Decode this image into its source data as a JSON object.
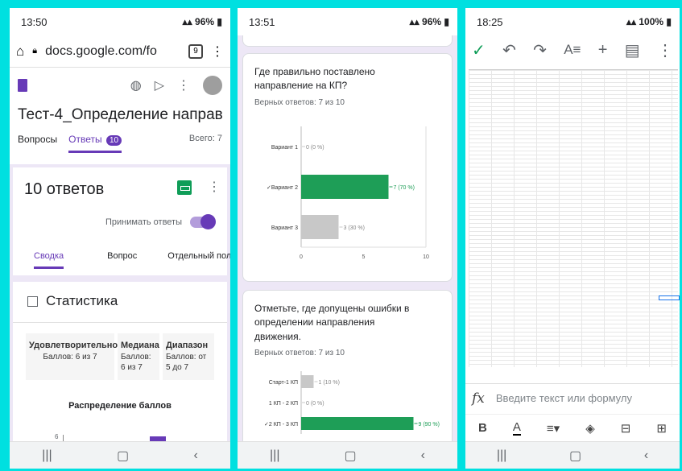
{
  "panel1": {
    "status": {
      "time": "13:50",
      "battery": "96%"
    },
    "url": "docs.google.com/fo",
    "tab_count": "9",
    "form_title": "Тест-4_Определение направл",
    "tabs": {
      "questions": "Вопросы",
      "responses": "Ответы",
      "responses_badge": "10",
      "total": "Всего: 7"
    },
    "responses_title": "10 ответов",
    "accept_label": "Принимать ответы",
    "subtabs": {
      "summary": "Сводка",
      "question": "Вопрос",
      "individual": "Отдельный польз"
    },
    "stats_title": "Статистика",
    "stats": [
      {
        "label": "Удовлетворительно",
        "value": "Баллов: 6 из 7"
      },
      {
        "label": "Медиана",
        "value": "Баллов: 6 из 7"
      },
      {
        "label": "Диапазон",
        "value": "Баллов: от 5 до 7"
      }
    ],
    "distribution_title": "Распределение баллов",
    "distribution_tick": "6"
  },
  "panel2": {
    "status": {
      "time": "13:51",
      "battery": "96%"
    },
    "q1": {
      "title": "Где правильно поставлено направление на КП?",
      "correct": "Верных ответов: 7 из 10"
    },
    "q2": {
      "title": "Отметьте, где допущены ошибки в определении направления движения.",
      "correct": "Верных ответов: 7 из 10"
    }
  },
  "panel3": {
    "status": {
      "time": "18:25",
      "battery": "100%"
    },
    "formula_placeholder": "Введите текст или формулу"
  },
  "colors": {
    "correct": "#1e9e57",
    "wrong": "#c8c8c8",
    "accent": "#673ab7"
  },
  "chart_data": [
    {
      "type": "bar",
      "orientation": "horizontal",
      "categories": [
        "Вариант 1",
        "✓Вариант 2",
        "Вариант 3"
      ],
      "values": [
        0,
        7,
        3
      ],
      "data_labels": [
        "0 (0 %)",
        "7 (70 %)",
        "3 (30 %)"
      ],
      "correct": [
        false,
        true,
        false
      ],
      "xlim": [
        0,
        10
      ],
      "xticks": [
        "0",
        "5",
        "10"
      ]
    },
    {
      "type": "bar",
      "orientation": "horizontal",
      "categories": [
        "Старт-1 КП",
        "1 КП - 2 КП",
        "✓2 КП - 3 КП"
      ],
      "values": [
        1,
        0,
        9
      ],
      "data_labels": [
        "1 (10 %)",
        "0 (0 %)",
        "9 (90 %)"
      ],
      "correct": [
        false,
        false,
        true
      ],
      "xlim": [
        0,
        10
      ]
    }
  ]
}
